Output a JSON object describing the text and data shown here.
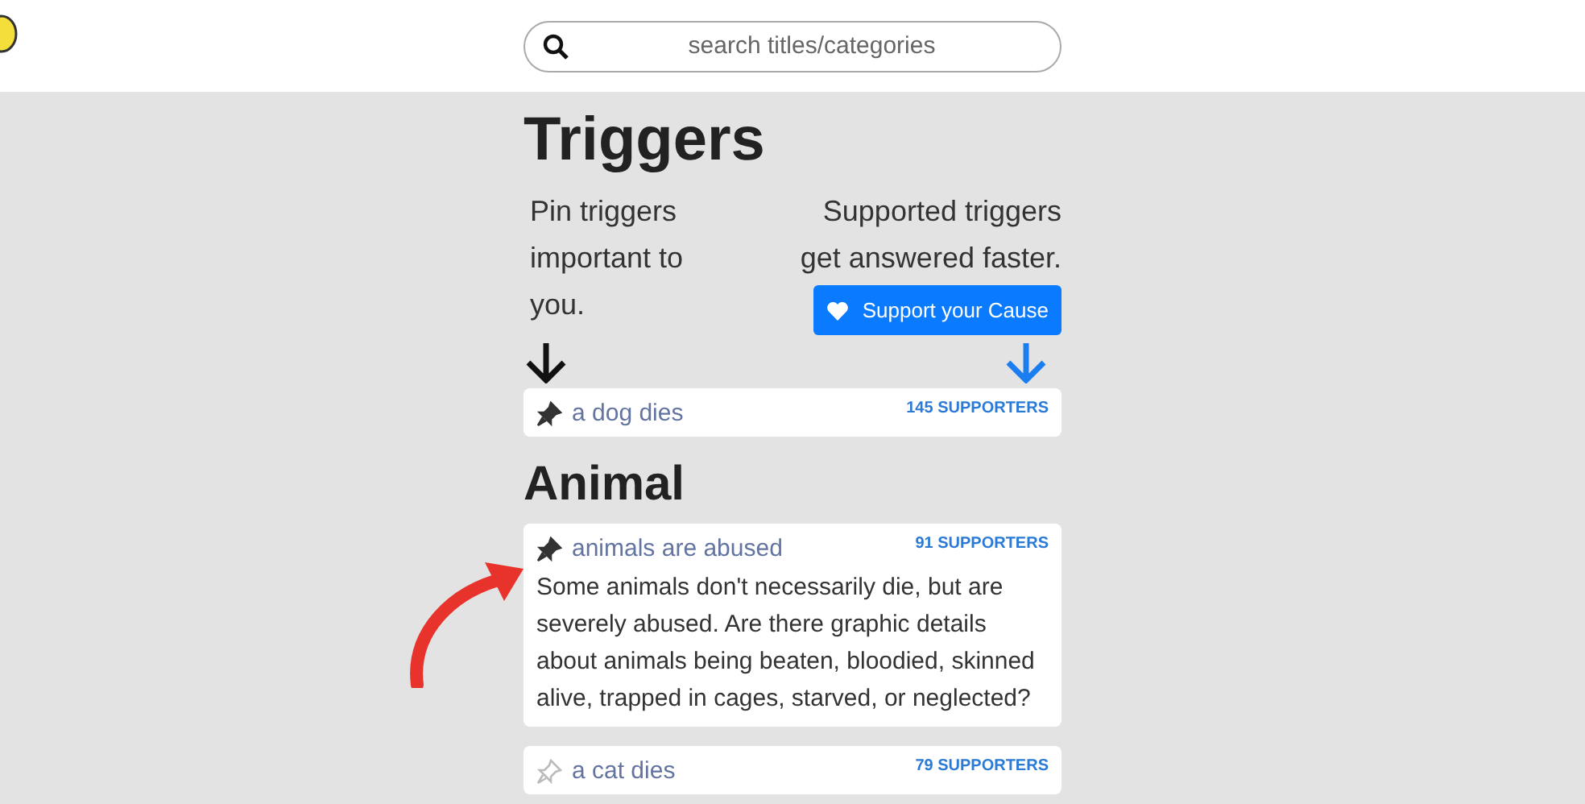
{
  "search": {
    "placeholder": "search titles/categories"
  },
  "title": "Triggers",
  "pin_hint": "Pin triggers important to you.",
  "support_hint": "Supported triggers get answered faster.",
  "support_button": "Support your Cause",
  "pinned": [
    {
      "label": "a dog dies",
      "supporters": "145 SUPPORTERS",
      "pinned": true
    }
  ],
  "category": {
    "title": "Animal",
    "items": [
      {
        "label": "animals are abused",
        "supporters": "91 SUPPORTERS",
        "pinned": true,
        "description": "Some animals don't necessarily die, but are severely abused. Are there graphic details about animals being beaten, bloodied, skinned alive, trapped in cages, starved, or neglected?"
      },
      {
        "label": "a cat dies",
        "supporters": "79 SUPPORTERS",
        "pinned": false
      }
    ]
  }
}
